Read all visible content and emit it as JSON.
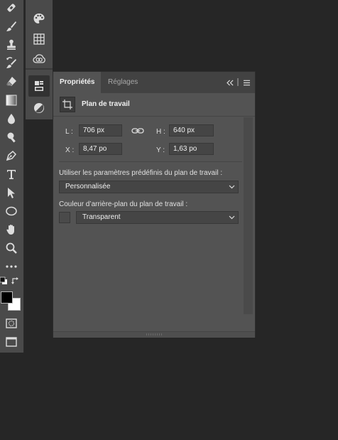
{
  "toolbar": {
    "tools": [
      "healing-brush",
      "brush",
      "clone-stamp",
      "history-brush",
      "eraser",
      "gradient",
      "blur",
      "dodge",
      "pen",
      "type",
      "path-selection",
      "ellipse",
      "hand",
      "zoom",
      "more",
      "default-colors",
      "swap-colors",
      "quick-mask",
      "screen-mode"
    ],
    "foreground_color": "#000000",
    "background_color": "#ffffff"
  },
  "strip": {
    "icons": [
      "color-palette-icon",
      "swatches-grid-icon",
      "creative-cloud-libraries-icon",
      "properties-icon",
      "adjustments-icon"
    ]
  },
  "panel": {
    "tabs": [
      {
        "label": "Propriétés",
        "active": true
      },
      {
        "label": "Réglages",
        "active": false
      }
    ],
    "title": "Plan de travail",
    "fields": {
      "w_label": "L :",
      "w_value": "706 px",
      "h_label": "H :",
      "h_value": "640 px",
      "x_label": "X :",
      "x_value": "8,47 po",
      "y_label": "Y :",
      "y_value": "1,63 po"
    },
    "preset_label": "Utiliser les paramètres prédéfinis du plan de travail :",
    "preset_value": "Personnalisée",
    "bg_label": "Couleur d’arrière-plan du plan de travail :",
    "bg_value": "Transparent"
  },
  "colors": {
    "app_bg": "#262626",
    "panel_bg": "#535353",
    "toolbar_bg": "#4a4a4a"
  }
}
